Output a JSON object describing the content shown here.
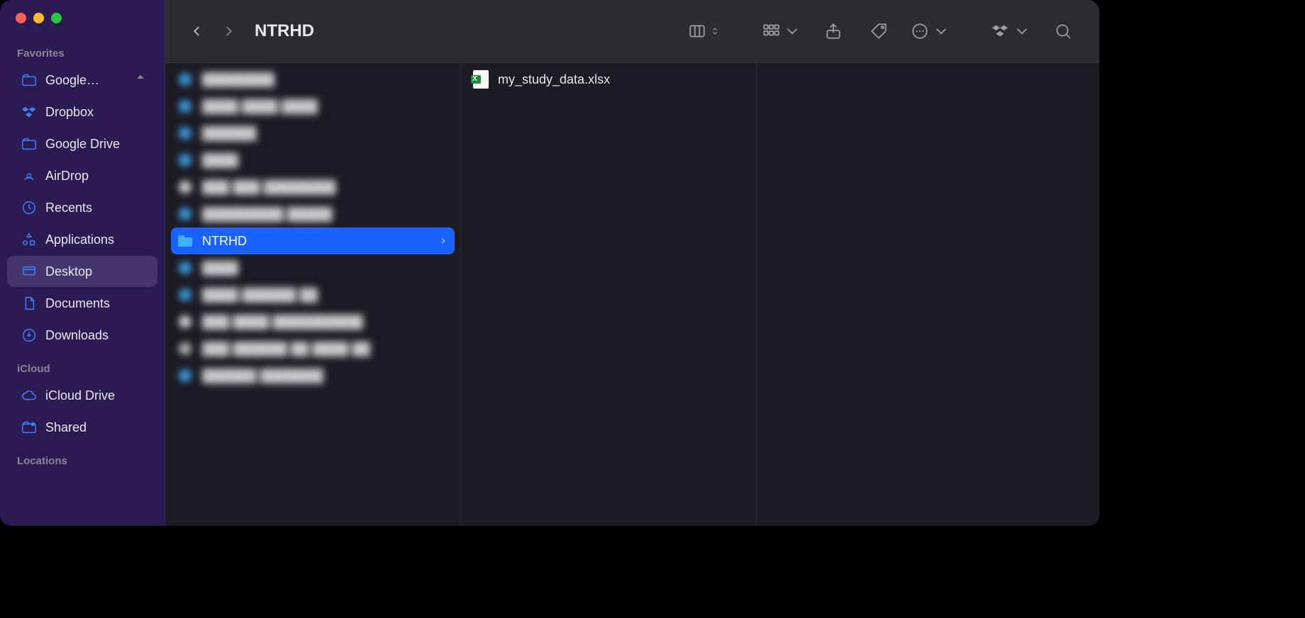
{
  "window": {
    "title": "NTRHD"
  },
  "sidebar": {
    "sections": [
      {
        "header": "Favorites",
        "items": [
          {
            "label": "Google…",
            "icon": "cloud-folder",
            "ejectable": true
          },
          {
            "label": "Dropbox",
            "icon": "dropbox"
          },
          {
            "label": "Google Drive",
            "icon": "cloud-folder"
          },
          {
            "label": "AirDrop",
            "icon": "airdrop"
          },
          {
            "label": "Recents",
            "icon": "clock"
          },
          {
            "label": "Applications",
            "icon": "apps"
          },
          {
            "label": "Desktop",
            "icon": "desktop",
            "active": true
          },
          {
            "label": "Documents",
            "icon": "document"
          },
          {
            "label": "Downloads",
            "icon": "download"
          }
        ]
      },
      {
        "header": "iCloud",
        "items": [
          {
            "label": "iCloud Drive",
            "icon": "icloud"
          },
          {
            "label": "Shared",
            "icon": "shared-folder"
          }
        ]
      },
      {
        "header": "Locations",
        "items": []
      }
    ]
  },
  "columns": [
    {
      "items": [
        {
          "name": "—",
          "blurred": true
        },
        {
          "name": "—",
          "blurred": true
        },
        {
          "name": "—",
          "blurred": true
        },
        {
          "name": "—",
          "blurred": true
        },
        {
          "name": "—",
          "blurred": true
        },
        {
          "name": "—",
          "blurred": true
        },
        {
          "name": "NTRHD",
          "selected": true,
          "is_folder": true
        },
        {
          "name": "—",
          "blurred": true
        },
        {
          "name": "—",
          "blurred": true
        },
        {
          "name": "—",
          "blurred": true
        },
        {
          "name": "—",
          "blurred": true
        },
        {
          "name": "—",
          "blurred": true
        }
      ]
    },
    {
      "items": [
        {
          "name": "my_study_data.xlsx",
          "file_type": "excel"
        }
      ]
    },
    {
      "items": []
    }
  ]
}
